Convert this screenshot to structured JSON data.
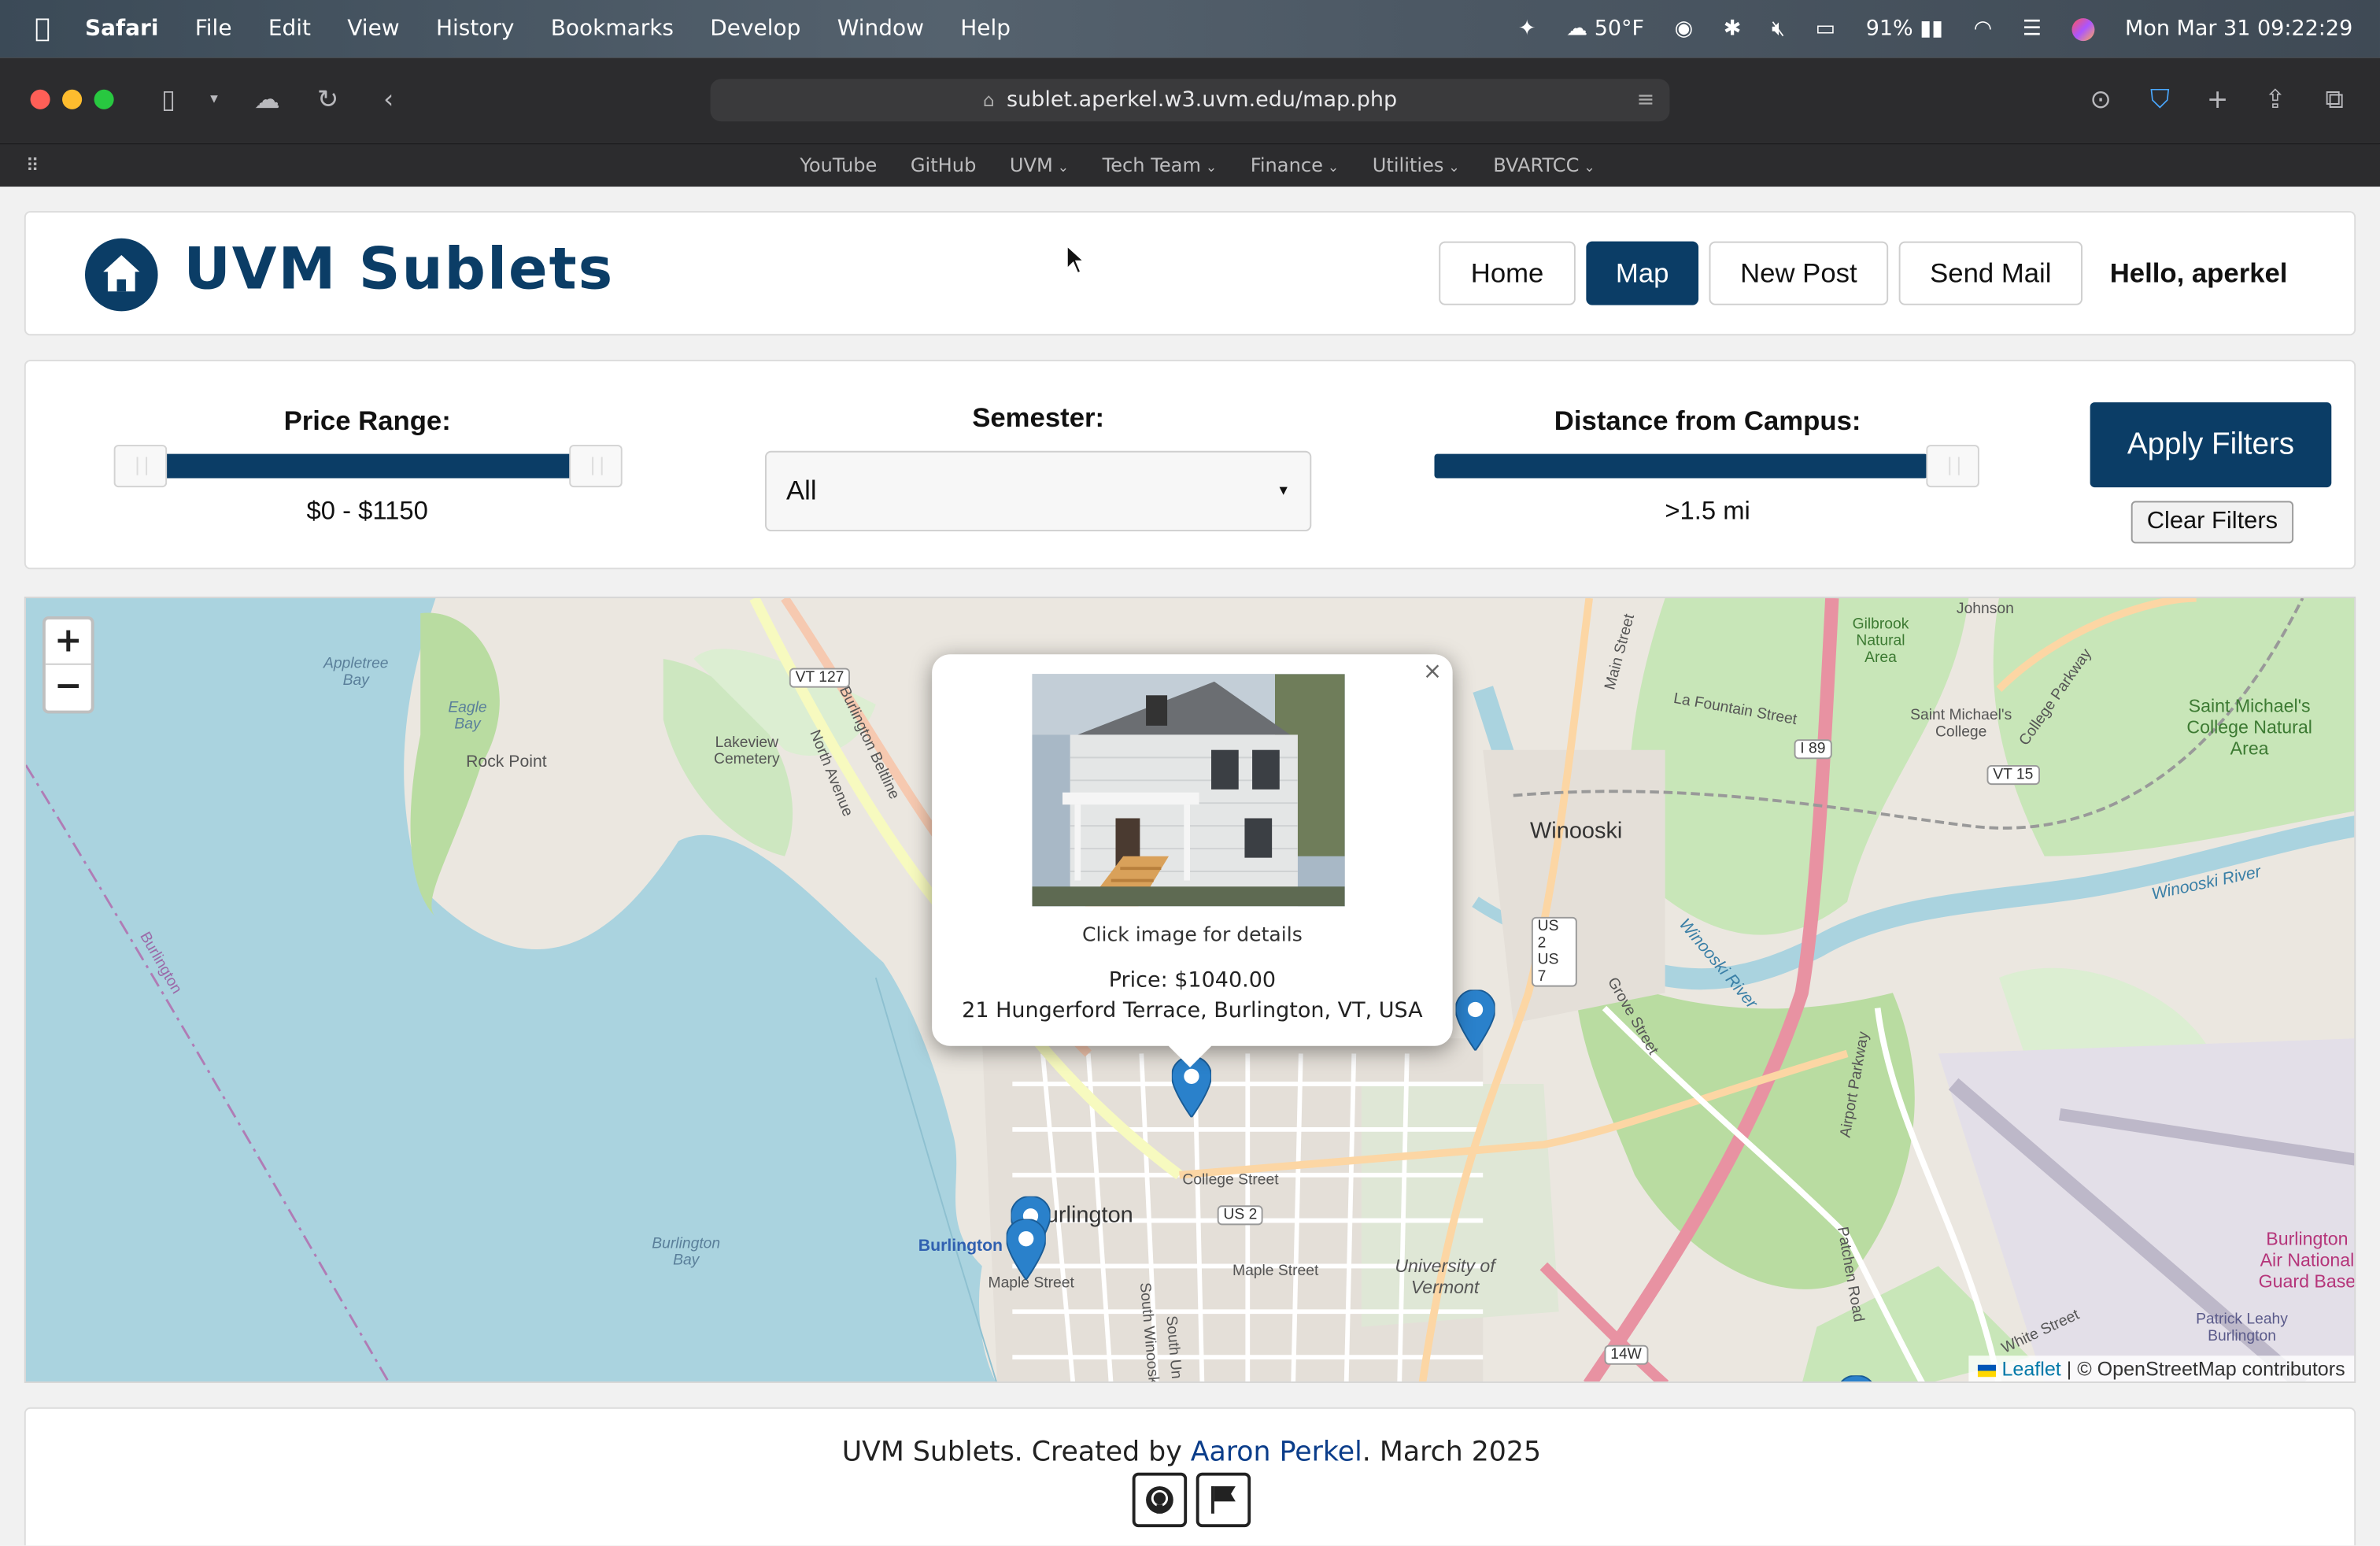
{
  "menubar": {
    "app": "Safari",
    "items": [
      "File",
      "Edit",
      "View",
      "History",
      "Bookmarks",
      "Develop",
      "Window",
      "Help"
    ],
    "weather": "50°F",
    "battery": "91%",
    "datetime": "Mon Mar 31  09:22:29"
  },
  "browser": {
    "url": "sublet.aperkel.w3.uvm.edu/map.php",
    "favorites": [
      {
        "label": "YouTube",
        "menu": false
      },
      {
        "label": "GitHub",
        "menu": false
      },
      {
        "label": "UVM",
        "menu": true
      },
      {
        "label": "Tech Team",
        "menu": true
      },
      {
        "label": "Finance",
        "menu": true
      },
      {
        "label": "Utilities",
        "menu": true
      },
      {
        "label": "BVARTCC",
        "menu": true
      }
    ]
  },
  "header": {
    "title": "UVM Sublets",
    "nav": {
      "home": "Home",
      "map": "Map",
      "new_post": "New Post",
      "send_mail": "Send Mail"
    },
    "greeting": "Hello, aperkel"
  },
  "filters": {
    "price_label": "Price Range:",
    "price_value": "$0 - $1150",
    "price_min_fraction": 0.0,
    "price_max_fraction": 1.0,
    "semester_label": "Semester:",
    "semester_value": "All",
    "distance_label": "Distance from Campus:",
    "distance_value": ">1.5 mi",
    "distance_fraction": 1.0,
    "apply_label": "Apply Filters",
    "clear_label": "Clear Filters"
  },
  "map": {
    "zoom_in": "+",
    "zoom_out": "−",
    "labels": {
      "winooski": "Winooski",
      "burlington": "Burlington",
      "burlington_small": "Burlington",
      "uvm": "University of Vermont",
      "lakeview": "Lakeview Cemetery",
      "rock_point": "Rock Point",
      "appletree_bay": "Appletree Bay",
      "eagle_bay": "Eagle Bay",
      "burlington_bay": "Burlington Bay",
      "burlington_lake": "Burlington",
      "smc": "Saint Michael's College",
      "smc_area": "Saint Michael's College Natural Area",
      "gilbrook": "Gilbrook Natural Area",
      "winooski_river": "Winooski River",
      "winooski_river2": "Winooski River",
      "college_street": "College Street",
      "maple_street": "Maple Street",
      "maple_street2": "Maple Street",
      "north_avenue": "North Avenue",
      "beltline": "Burlington Beltline",
      "la_fountain": "La Fountain Street",
      "main_street": "Main Street",
      "grove_street": "Grove Street",
      "patchen_road": "Patchen Road",
      "airport_parkway": "Airport Parkway",
      "south_winooski": "South Winooski",
      "airport": "Burlington Air National Guard Base",
      "patrick_leahy": "Patrick Leahy Burlington",
      "white_street": "White Street",
      "college_parkway": "College Parkway",
      "johnson": "Johnson",
      "south_union": "South Un"
    },
    "signs": {
      "vt127": "VT 127",
      "i89": "I 89",
      "vt15": "VT 15",
      "us2": "US 2",
      "us2us7": "US 2 US 7",
      "i14w": "14W"
    },
    "attribution_leaflet": "Leaflet",
    "attribution_osm": "| © OpenStreetMap contributors",
    "popup": {
      "close": "×",
      "caption": "Click image for details",
      "price": "Price: $1040.00",
      "address": "21 Hungerford Terrace, Burlington, VT, USA"
    }
  },
  "footer": {
    "text_before": "UVM Sublets. Created by ",
    "author": "Aaron Perkel",
    "text_after": ". March 2025"
  },
  "colors": {
    "brand": "#0b3d66",
    "marker": "#2a81cb",
    "lake": "#aad3df",
    "park": "#c8e6b8"
  }
}
